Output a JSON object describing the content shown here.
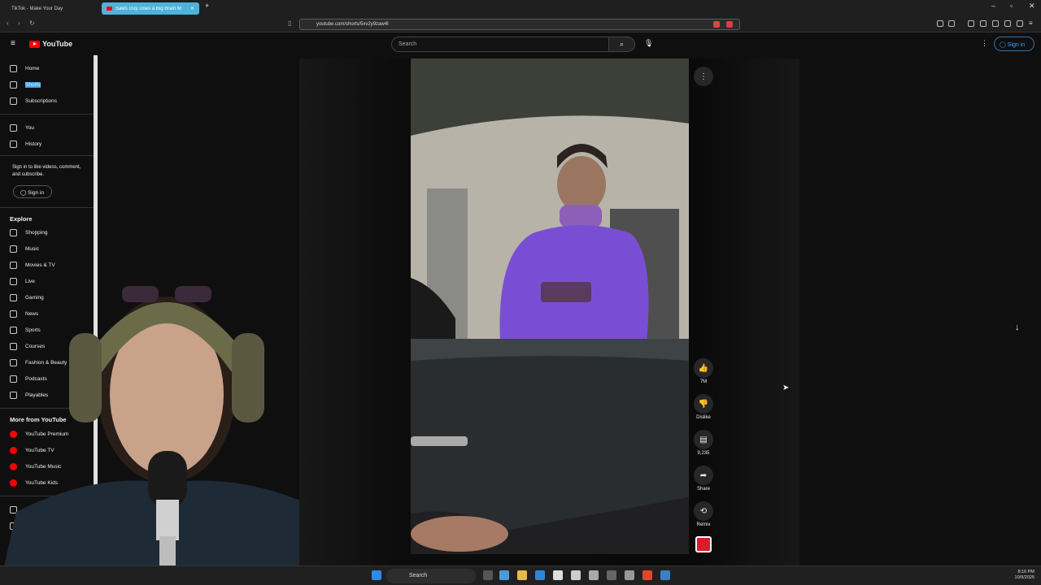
{
  "browser": {
    "tabs": [
      {
        "title": "TikTok - Make Your Day"
      },
      {
        "title": "Sales Guy Does a Big Brain M"
      }
    ],
    "url": "youtube.com/shorts/5xv2y9zaw4I"
  },
  "header": {
    "logo_text": "YouTube",
    "search_placeholder": "Search",
    "signin_label": "Sign in"
  },
  "sidebar": {
    "top": [
      {
        "label": "Home",
        "icon": "home-icon"
      },
      {
        "label": "Shorts",
        "icon": "shorts-icon"
      },
      {
        "label": "Subscriptions",
        "icon": "subscriptions-icon"
      }
    ],
    "you": [
      {
        "label": "You",
        "icon": "you-icon"
      },
      {
        "label": "History",
        "icon": "history-icon"
      }
    ],
    "signin_prompt": "Sign in to like videos, comment, and subscribe.",
    "signin_label": "Sign in",
    "explore_title": "Explore",
    "explore": [
      {
        "label": "Shopping"
      },
      {
        "label": "Music"
      },
      {
        "label": "Movies & TV"
      },
      {
        "label": "Live"
      },
      {
        "label": "Gaming"
      },
      {
        "label": "News"
      },
      {
        "label": "Sports"
      },
      {
        "label": "Courses"
      },
      {
        "label": "Fashion & Beauty"
      },
      {
        "label": "Podcasts"
      },
      {
        "label": "Playables"
      }
    ],
    "more_title": "More from YouTube",
    "more": [
      {
        "label": "YouTube Premium"
      },
      {
        "label": "YouTube TV"
      },
      {
        "label": "YouTube Music"
      },
      {
        "label": "YouTube Kids"
      }
    ]
  },
  "actions": {
    "likes": "7M",
    "dislike": "Dislike",
    "comments": "9,235",
    "share": "Share",
    "remix": "Remix"
  },
  "taskbar": {
    "search_label": "Search",
    "time": "8:16 PM",
    "date": "10/9/2025"
  },
  "colors": {
    "accent": "#ff0000",
    "link": "#3ea6ff",
    "tab_active": "#4fb3d9"
  }
}
